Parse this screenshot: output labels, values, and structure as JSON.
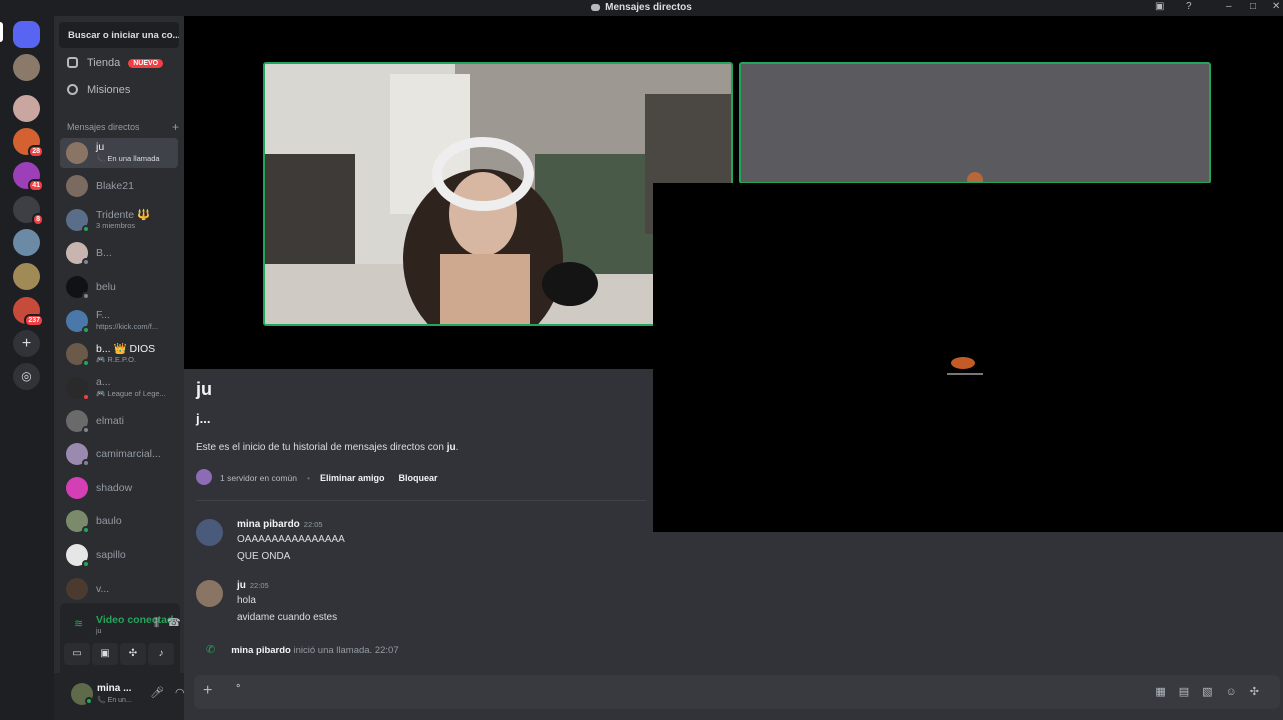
{
  "window": {
    "title": "Mensajes directos",
    "controls": [
      "–",
      "□",
      "✕"
    ]
  },
  "rail": {
    "badges": [
      "28",
      "41",
      "8",
      "237"
    ]
  },
  "sidebar": {
    "search_placeholder": "Buscar o iniciar una co...",
    "shop_label": "Tienda",
    "shop_badge": "NUEVO",
    "quests_label": "Misiones",
    "dm_header": "Mensajes directos",
    "dms": [
      {
        "name": "ju",
        "sub": "📞 En una llamada"
      },
      {
        "name": "Blake21",
        "sub": ""
      },
      {
        "name": "Tridente 🔱",
        "sub": "3 miembros"
      },
      {
        "name": "B...",
        "sub": ""
      },
      {
        "name": "belu",
        "sub": ""
      },
      {
        "name": "F...",
        "sub": "https://kick.com/f..."
      },
      {
        "name": "b... 👑 DIOS",
        "sub": "🎮 R.E.P.O."
      },
      {
        "name": "a...",
        "sub": "🎮 League of Lege..."
      },
      {
        "name": "elmati",
        "sub": ""
      },
      {
        "name": "camimarcial...",
        "sub": ""
      },
      {
        "name": "shadow",
        "sub": ""
      },
      {
        "name": "baulo",
        "sub": ""
      },
      {
        "name": "sapillo",
        "sub": ""
      },
      {
        "name": "v...",
        "sub": ""
      }
    ]
  },
  "voice": {
    "status": "Video conectad",
    "channel": "ju"
  },
  "user": {
    "name": "mina ...",
    "status": "📞 En un..."
  },
  "chat": {
    "title": "ju",
    "username": "j...",
    "intro_prefix": "Este es el inicio de tu historial de mensajes directos con ",
    "intro_name": "ju",
    "intro_suffix": ".",
    "mutual": "1 servidor en común",
    "remove_friend": "Eliminar amigo",
    "block": "Bloquear",
    "messages": [
      {
        "author": "mina pibardo",
        "time": "22:05",
        "lines": [
          "OAAAAAAAAAAAAAAA",
          "QUE ONDA"
        ]
      },
      {
        "author": "ju",
        "time": "22:05",
        "lines": [
          "hola",
          "avidame cuando estes"
        ]
      }
    ],
    "call_author": "mina pibardo",
    "call_text": " inició una llamada. 22:07",
    "composer_text": "°"
  }
}
